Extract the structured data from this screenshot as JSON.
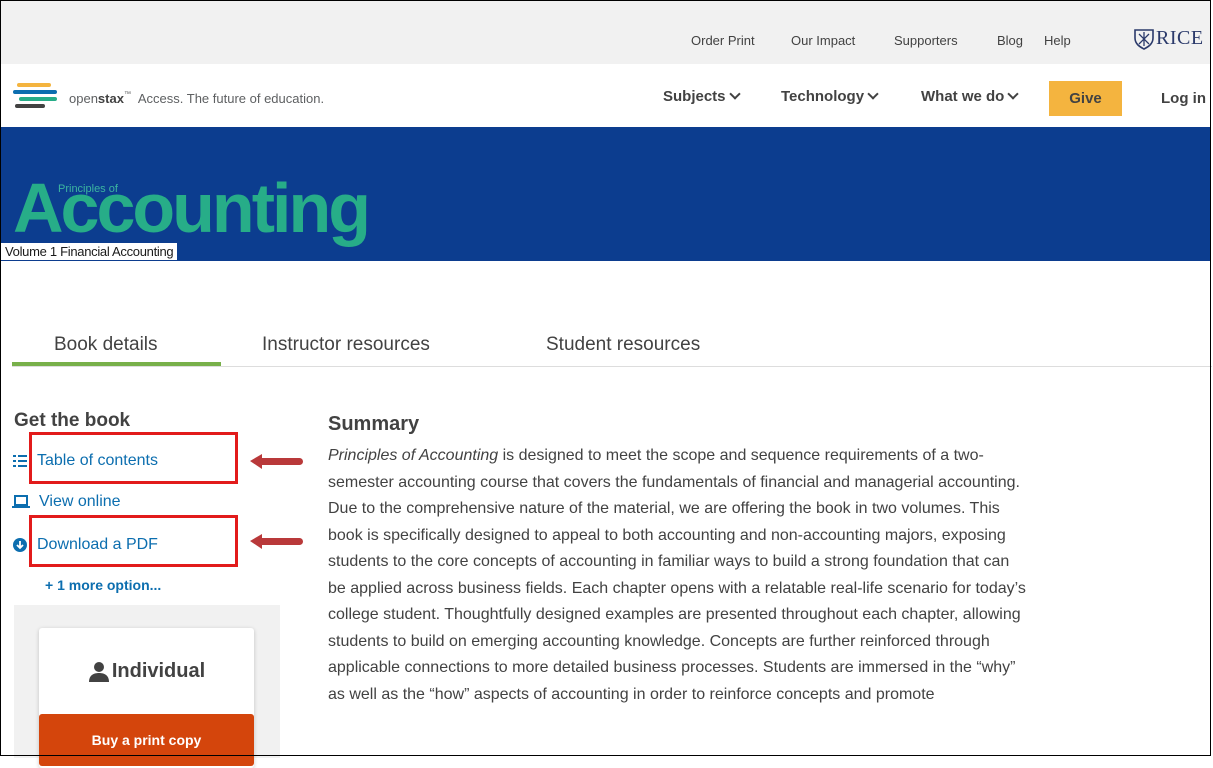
{
  "utility_nav": {
    "links": [
      "Order Print",
      "Our Impact",
      "Supporters",
      "Blog",
      "Help"
    ],
    "rice_text": "RICE"
  },
  "main_nav": {
    "brand_name_light": "open",
    "brand_name_bold": "stax",
    "brand_tm": "™",
    "tagline": "Access. The future of education.",
    "items": [
      "Subjects",
      "Technology",
      "What we do"
    ],
    "give_label": "Give",
    "login_label": "Log in"
  },
  "logo_colors": [
    "#f4b43f",
    "#0c6eaf",
    "#27ad88",
    "#424242"
  ],
  "hero": {
    "small_title": "Principles of",
    "big_title": "Accounting",
    "volume": "Volume 1 Financial Accounting",
    "background": "#0c3d8f",
    "title_color": "#27ad88"
  },
  "tabs": [
    "Book details",
    "Instructor resources",
    "Student resources"
  ],
  "sidebar": {
    "heading": "Get the book",
    "links": [
      {
        "label": "Table of contents",
        "icon": "list-icon"
      },
      {
        "label": "View online",
        "icon": "laptop-icon"
      },
      {
        "label": "Download a PDF",
        "icon": "cloud-download-icon"
      }
    ],
    "more_options": "+ 1 more option...",
    "card_title": "Individual",
    "buy_label": "Buy a print copy"
  },
  "annotations": {
    "highlight_color": "#e21b1b",
    "arrow_color": "#b9393a"
  },
  "summary": {
    "heading": "Summary",
    "title_italic": "Principles of Accounting",
    "first_line_rest": " is designed to meet the scope and sequence requirements of a two-",
    "lines": [
      "semester accounting course that covers the fundamentals of financial and managerial accounting.",
      "Due to the comprehensive nature of the material, we are offering the book in two volumes. This",
      "book is specifically designed to appeal to both accounting and non-accounting majors, exposing",
      "students to the core concepts of accounting in familiar ways to build a strong foundation that can",
      "be applied across business fields. Each chapter opens with a relatable real-life scenario for today’s",
      "college student. Thoughtfully designed examples are presented throughout each chapter, allowing",
      "students to build on emerging accounting knowledge. Concepts are further reinforced through",
      "applicable connections to more detailed business processes. Students are immersed in the “why”",
      "as well as the “how” aspects of accounting in order to reinforce concepts and promote"
    ]
  }
}
